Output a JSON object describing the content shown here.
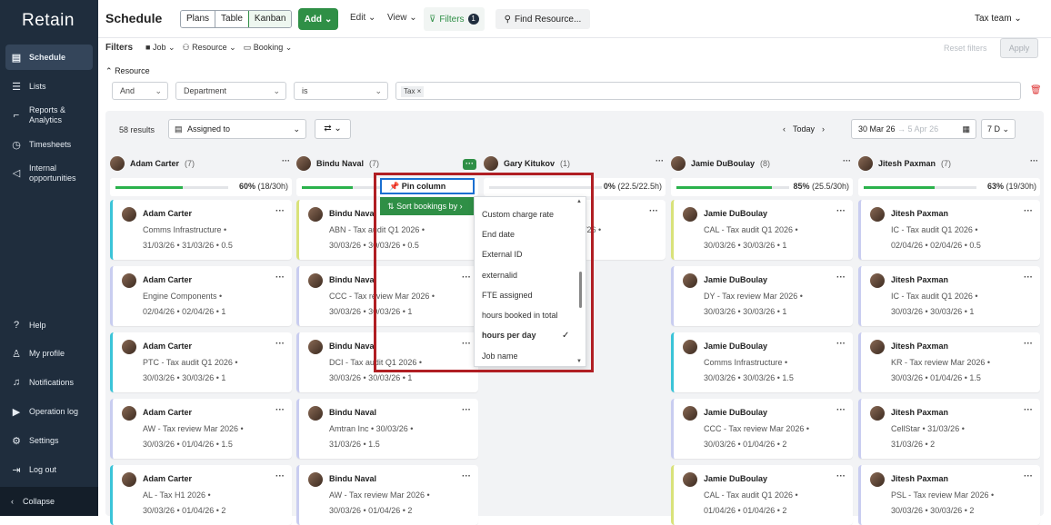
{
  "sidebar": {
    "logo": "Retain",
    "items": [
      {
        "label": "Schedule",
        "icon": "calendar-icon"
      },
      {
        "label": "Lists",
        "icon": "list-icon"
      },
      {
        "label": "Reports & Analytics",
        "icon": "chart-icon"
      },
      {
        "label": "Timesheets",
        "icon": "clock-icon"
      },
      {
        "label": "Internal opportunities",
        "icon": "megaphone-icon"
      }
    ],
    "bottom_items": [
      {
        "label": "Help",
        "icon": "help-icon"
      },
      {
        "label": "My profile",
        "icon": "user-icon"
      },
      {
        "label": "Notifications",
        "icon": "bell-icon"
      },
      {
        "label": "Operation log",
        "icon": "log-icon"
      },
      {
        "label": "Settings",
        "icon": "gear-icon"
      },
      {
        "label": "Log out",
        "icon": "logout-icon"
      }
    ],
    "collapse": "Collapse"
  },
  "header": {
    "title": "Schedule",
    "views": [
      "Plans",
      "Table",
      "Kanban"
    ],
    "add": "Add",
    "edit": "Edit",
    "view": "View",
    "filters": "Filters",
    "filters_count": "1",
    "find": "Find Resource...",
    "team": "Tax team"
  },
  "filterbar": {
    "label": "Filters",
    "job": "Job",
    "resource": "Resource",
    "booking": "Booking",
    "reset": "Reset filters",
    "apply": "Apply",
    "resource_section": "Resource",
    "and": "And",
    "field": "Department",
    "op": "is",
    "value_tag": "Tax ×"
  },
  "board": {
    "results": "58 results",
    "group_by": "Assigned to",
    "today": "Today",
    "date_from": "30 Mar 26",
    "date_to": "→  5 Apr 26",
    "range": "7 D"
  },
  "columns": [
    {
      "name": "Adam Carter",
      "count": "(7)",
      "pct": "60%",
      "hours": "(18/30h)",
      "fill": 0.6
    },
    {
      "name": "Bindu Naval",
      "count": "(7)",
      "pct": "",
      "hours": "",
      "fill": 0.45
    },
    {
      "name": "Gary Kitukov",
      "count": "(1)",
      "pct": "0%",
      "hours": "(22.5/22.5h)",
      "fill": 0
    },
    {
      "name": "Jamie DuBoulay",
      "count": "(8)",
      "pct": "85%",
      "hours": "(25.5/30h)",
      "fill": 0.85
    },
    {
      "name": "Jitesh Paxman",
      "count": "(7)",
      "pct": "63%",
      "hours": "(19/30h)",
      "fill": 0.63
    }
  ],
  "cards": {
    "adam": [
      {
        "name": "Adam Carter",
        "proj": "Comms Infrastructure  •",
        "dates": "31/03/26  •  31/03/26  •  0.5"
      },
      {
        "name": "Adam Carter",
        "proj": "Engine Components  •",
        "dates": "02/04/26  •  02/04/26  •  1"
      },
      {
        "name": "Adam Carter",
        "proj": "PTC - Tax audit Q1 2026  •",
        "dates": "30/03/26  •  30/03/26  •  1"
      },
      {
        "name": "Adam Carter",
        "proj": "AW - Tax review Mar 2026  •",
        "dates": "30/03/26  •  01/04/26  •  1.5"
      },
      {
        "name": "Adam Carter",
        "proj": "AL - Tax H1 2026  •",
        "dates": "30/03/26  •  01/04/26  •  2"
      }
    ],
    "bindu": [
      {
        "name": "Bindu Naval",
        "proj": "ABN - Tax audit Q1 2026  •",
        "dates": "30/03/26  •  30/03/26  •  0.5"
      },
      {
        "name": "Bindu Naval",
        "proj": "CCC - Tax review Mar 2026  •",
        "dates": "30/03/26  •  30/03/26  •  1"
      },
      {
        "name": "Bindu Naval",
        "proj": "DCI - Tax audit Q1 2026  •",
        "dates": "30/03/26  •  30/03/26  •  1"
      },
      {
        "name": "Bindu Naval",
        "proj": "Amtran Inc  •  30/03/26  •",
        "dates": "31/03/26  •  1.5"
      },
      {
        "name": "Bindu Naval",
        "proj": "AW - Tax review Mar 2026  •",
        "dates": "30/03/26  •  01/04/26  •  2"
      }
    ],
    "gary": [
      {
        "name": "",
        "proj": "/26  •",
        "dates": ""
      }
    ],
    "jamie": [
      {
        "name": "Jamie DuBoulay",
        "proj": "CAL - Tax audit Q1 2026  •",
        "dates": "30/03/26  •  30/03/26  •  1"
      },
      {
        "name": "Jamie DuBoulay",
        "proj": "DY - Tax review Mar 2026  •",
        "dates": "30/03/26  •  30/03/26  •  1"
      },
      {
        "name": "Jamie DuBoulay",
        "proj": "Comms Infrastructure  •",
        "dates": "30/03/26  •  30/03/26  •  1.5"
      },
      {
        "name": "Jamie DuBoulay",
        "proj": "CCC - Tax review Mar 2026  •",
        "dates": "30/03/26  •  01/04/26  •  2"
      },
      {
        "name": "Jamie DuBoulay",
        "proj": "CAL - Tax audit Q1 2026  •",
        "dates": "01/04/26  •  01/04/26  •  2"
      }
    ],
    "jitesh": [
      {
        "name": "Jitesh Paxman",
        "proj": "IC - Tax audit Q1 2026  •",
        "dates": "02/04/26  •  02/04/26  •  0.5"
      },
      {
        "name": "Jitesh Paxman",
        "proj": "IC - Tax audit Q1 2026  •",
        "dates": "30/03/26  •  30/03/26  •  1"
      },
      {
        "name": "Jitesh Paxman",
        "proj": "KR - Tax review Mar 2026  •",
        "dates": "30/03/26  •  01/04/26  •  1.5"
      },
      {
        "name": "Jitesh Paxman",
        "proj": "CellStar  •  31/03/26  •",
        "dates": "31/03/26  •  2"
      },
      {
        "name": "Jitesh Paxman",
        "proj": "PSL - Tax review Mar 2026  •",
        "dates": "30/03/26  •  30/03/26  •  2"
      }
    ]
  },
  "popup": {
    "pin": "Pin column",
    "sort": "Sort bookings by",
    "options": [
      "Custom charge rate",
      "End date",
      "External ID",
      "externalid",
      "FTE assigned",
      "hours booked in total",
      "hours per day",
      "Job name"
    ],
    "selected": "hours per day"
  },
  "colors": {
    "accent": "#2f8f46",
    "sidebar": "#1f2d3d",
    "highlight": "#b01e23",
    "focus": "#1a6fd1"
  }
}
